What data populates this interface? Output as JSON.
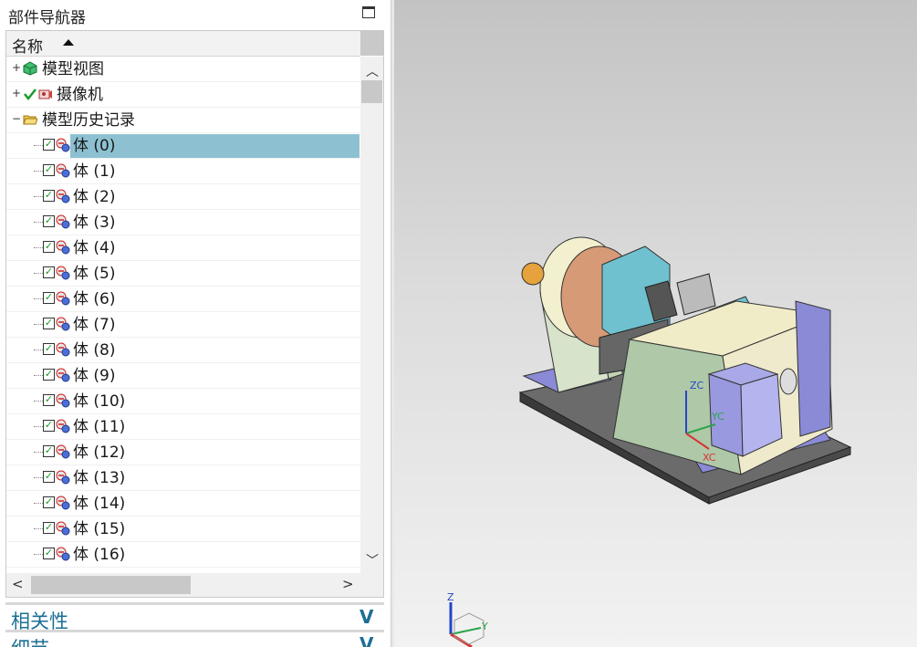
{
  "navigator": {
    "title": "部件导航器",
    "column_name": "名称",
    "items": [
      {
        "label": "模型视图",
        "expander": "+",
        "level": 0
      },
      {
        "label": "摄像机",
        "expander": "+",
        "level": 0
      },
      {
        "label": "模型历史记录",
        "expander": "−",
        "level": 0
      }
    ],
    "bodies": [
      "体 (0)",
      "体 (1)",
      "体 (2)",
      "体 (3)",
      "体 (4)",
      "体 (5)",
      "体 (6)",
      "体 (7)",
      "体 (8)",
      "体 (9)",
      "体 (10)",
      "体 (11)",
      "体 (12)",
      "体 (13)",
      "体 (14)",
      "体 (15)",
      "体 (16)"
    ],
    "selected_index": 0
  },
  "sections": {
    "dependencies": "相关性",
    "details": "细节"
  },
  "viewport": {
    "axis_labels": {
      "zc": "ZC",
      "yc": "YC",
      "xc": "XC"
    },
    "triad_labels": {
      "z": "Z",
      "y": "Y"
    }
  },
  "icons": {
    "expander": "plus-minus-box",
    "model_views": "cube-view-icon",
    "camera": "camera-icon",
    "history_folder": "folder-open-icon",
    "body": "body-feature-icon",
    "checkbox": "checkbox-checked"
  },
  "colors": {
    "selection": "#8dc1d1",
    "section_text": "#1c6f96",
    "check_green": "#1a9a2a"
  }
}
